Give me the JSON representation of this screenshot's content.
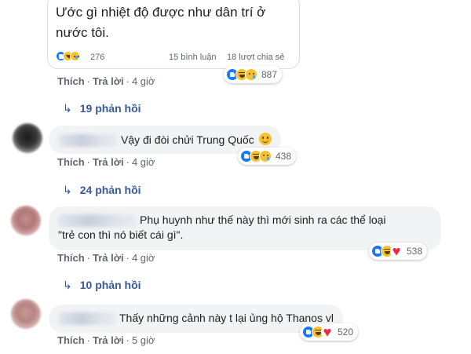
{
  "post": {
    "text": "Ước gì nhiệt độ được như dân trí ở nước tôi.",
    "reaction_count": "276",
    "comments_label": "15 bình luận",
    "shares_label": "18 lượt chia sẻ",
    "reactions": [
      "like",
      "haha",
      "sad"
    ]
  },
  "actions": {
    "like_label": "Thích",
    "reply_label": "Trả lời",
    "separator": "·"
  },
  "top_action_row": {
    "time": "4 giờ",
    "reaction_count": "887",
    "reactions": [
      "like",
      "haha",
      "sad"
    ]
  },
  "comments": [
    {
      "replies_label": "19 phản hồi",
      "text": "Vậy đi đòi chửi Trung Quốc",
      "emoji": "slightly-smiling-face",
      "time": "4 giờ",
      "reaction_count": "438",
      "reactions": [
        "like",
        "haha",
        "sad"
      ]
    },
    {
      "replies_label": "24 phản hồi",
      "text_line1": "Phụ huynh như thế này thì mới sinh ra các thể loại",
      "text_line2": "\"trẻ con thì nó biết cái gì\".",
      "time": "4 giờ",
      "reaction_count": "538",
      "reactions": [
        "like",
        "haha",
        "love"
      ]
    },
    {
      "replies_label": "10 phản hồi",
      "text": "Thấy những cảnh này t lại ủng hộ Thanos vl",
      "time": "5 giờ",
      "reaction_count": "520",
      "reactions": [
        "like",
        "haha",
        "love"
      ]
    }
  ],
  "colors": {
    "link": "#385898",
    "meta": "#606770",
    "bubble": "#f2f3f5",
    "like": "#1877f2",
    "haha": "#f7c02f",
    "love": "#f02849"
  }
}
